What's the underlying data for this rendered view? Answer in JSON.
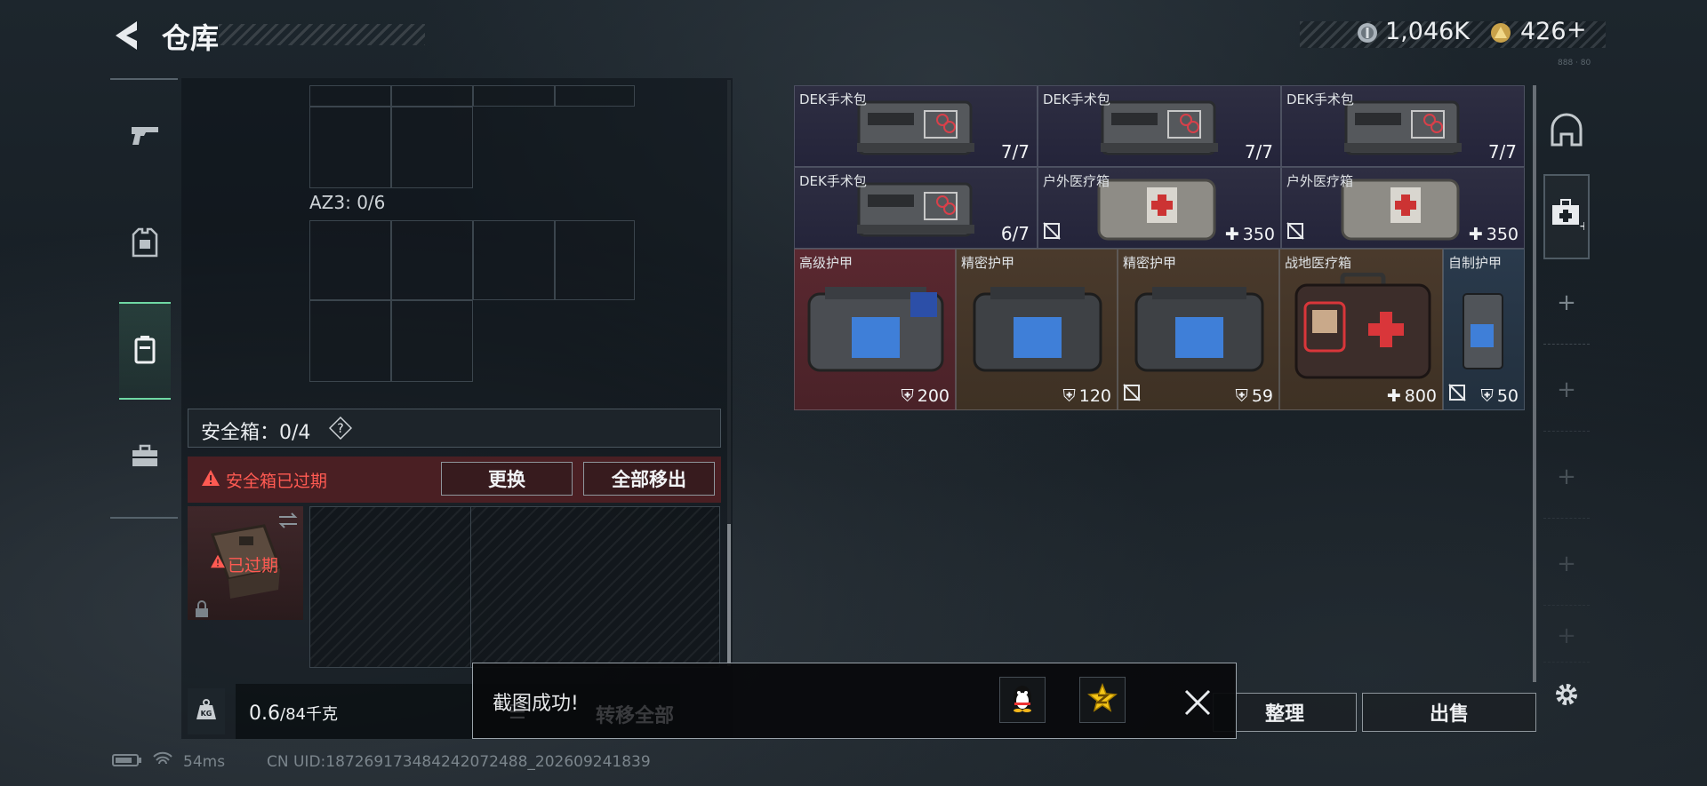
{
  "header": {
    "title": "仓库",
    "currency_1": "1,046K",
    "currency_2": "426",
    "currency_2_add": "+",
    "corner_tiny": "888 · 80"
  },
  "left_nav": {
    "items": [
      {
        "name": "weapon",
        "icon": "pistol-icon"
      },
      {
        "name": "equipment",
        "icon": "armor-vest-icon"
      },
      {
        "name": "backpack",
        "icon": "backpack-icon",
        "active": true
      },
      {
        "name": "case",
        "icon": "briefcase-icon"
      }
    ]
  },
  "container": {
    "az3_label": "AZ3: 0/6"
  },
  "safebox": {
    "label": "安全箱：0/4",
    "help": "?",
    "expired_text": "安全箱已过期",
    "replace_label": "更换",
    "remove_all_label": "全部移出",
    "item_expired": "已过期"
  },
  "weight": {
    "current": "0.6",
    "max": "/84千克"
  },
  "bottom_actions": {
    "transfer_all_label": "转移全部",
    "organize_label": "整理",
    "sell_label": "出售"
  },
  "toast": {
    "text": "截图成功!"
  },
  "inventory": [
    {
      "name": "DEK手术包",
      "qty": "7/7"
    },
    {
      "name": "DEK手术包",
      "qty": "7/7"
    },
    {
      "name": "DEK手术包",
      "qty": "7/7"
    },
    {
      "name": "DEK手术包",
      "qty": "6/7"
    },
    {
      "name": "户外医疗箱",
      "value": "350"
    },
    {
      "name": "户外医疗箱",
      "value": "350"
    },
    {
      "name": "高级护甲",
      "value": "200"
    },
    {
      "name": "精密护甲",
      "value": "120"
    },
    {
      "name": "精密护甲",
      "value": "59"
    },
    {
      "name": "战地医疗箱",
      "value": "800"
    },
    {
      "name": "自制护甲",
      "value": "50"
    }
  ],
  "status_bar": {
    "ping": "54ms",
    "uid": "CN UID:187269173484242072488_202609241839"
  },
  "colors": {
    "accent_green": "#6fd9a4",
    "warning_red": "#ff5a52",
    "rarity_purple": "#2e2e42",
    "rarity_red": "#5a2830",
    "rarity_gold": "#4a3a2c",
    "rarity_blue": "#2a3a4c"
  }
}
